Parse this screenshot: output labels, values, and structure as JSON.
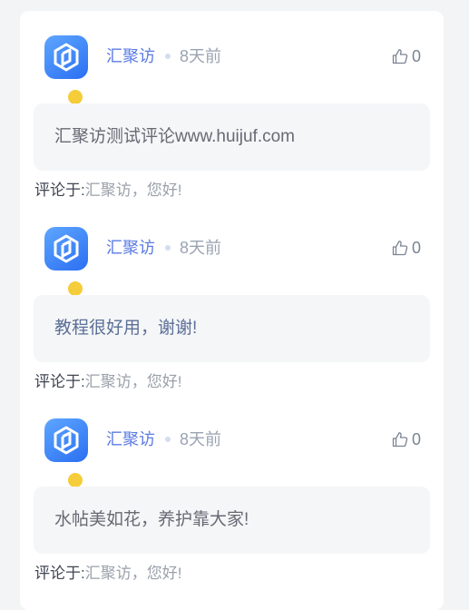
{
  "comments": [
    {
      "author": "汇聚访",
      "time": "8天前",
      "likes": "0",
      "text": "汇聚访测试评论www.huijuf.com",
      "reply_label": "评论于:",
      "reply_target": "汇聚访，您好!"
    },
    {
      "author": "汇聚访",
      "time": "8天前",
      "likes": "0",
      "text": "教程很好用，谢谢!",
      "reply_label": "评论于:",
      "reply_target": "汇聚访，您好!"
    },
    {
      "author": "汇聚访",
      "time": "8天前",
      "likes": "0",
      "text": "水帖美如花，养护靠大家!",
      "reply_label": "评论于:",
      "reply_target": "汇聚访，您好!"
    }
  ],
  "colors": {
    "author": "#5b7be4",
    "avatar_gradient": [
      "#5ea6ff",
      "#2b6ff2"
    ],
    "badge": "#f5cc3a",
    "bubble_bg": "#f5f6f8"
  },
  "icons": {
    "like": "thumbs-up-icon",
    "avatar": "site-logo-icon",
    "badge": "user-badge-icon"
  }
}
